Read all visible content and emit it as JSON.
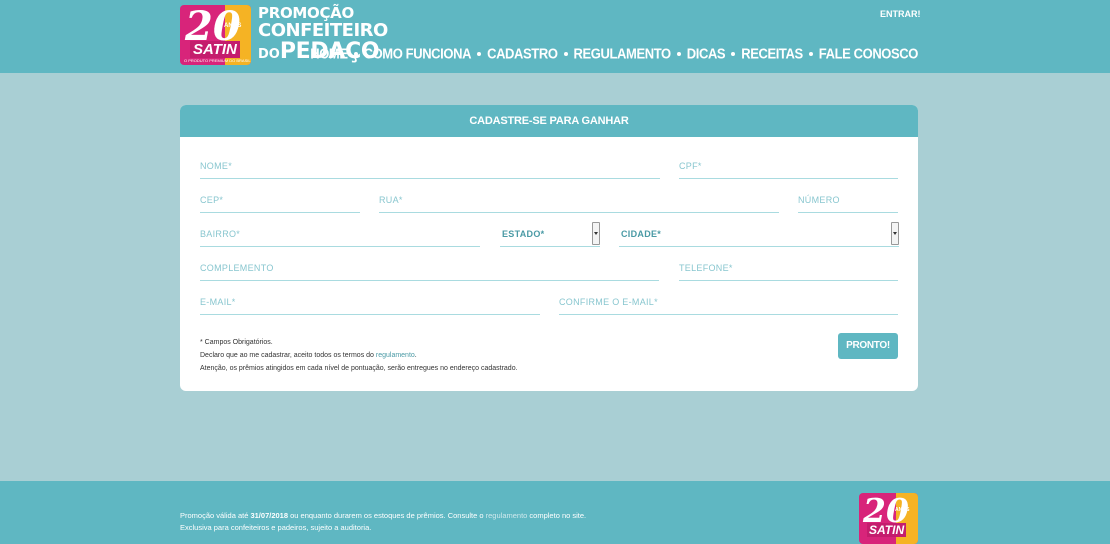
{
  "header": {
    "logo": {
      "number": "20",
      "anos": "ANOS",
      "brand": "SATIN",
      "tagline": "O PRODUTO PREMIUM DO BRASIL"
    },
    "promo_line1": "PROMOÇÃO",
    "promo_line2": "CONFEITEIRO",
    "promo_line3_small": "DO",
    "promo_line3_big": "PEDAÇO",
    "login_link": "ENTRAR!",
    "nav": [
      "HOME",
      "COMO FUNCIONA",
      "CADASTRO",
      "REGULAMENTO",
      "DICAS",
      "RECEITAS",
      "FALE CONOSCO"
    ]
  },
  "form": {
    "title": "CADASTRE-SE PARA GANHAR",
    "fields": {
      "nome": "NOME*",
      "cpf": "CPF*",
      "cep": "CEP*",
      "rua": "RUA*",
      "numero": "NÚMERO",
      "bairro": "BAIRRO*",
      "estado": "ESTADO*",
      "cidade": "CIDADE*",
      "complemento": "COMPLEMENTO",
      "telefone": "TELEFONE*",
      "email": "E-MAIL*",
      "confirm_email": "CONFIRME O E-MAIL*"
    },
    "notes": {
      "required": "* Campos Obrigatórios.",
      "declare_prefix": "Declaro que ao me cadastrar, aceito todos os termos do ",
      "declare_link": "regulamento",
      "declare_suffix": ".",
      "attention": "Atenção, os prêmios atingidos em cada nível de pontuação, serão entregues no endereço cadastrado."
    },
    "submit_label": "PRONTO!"
  },
  "footer": {
    "line1_prefix": "Promoção válida até ",
    "line1_date": "31/07/2018",
    "line1_mid": " ou enquanto durarem os estoques de prêmios. Consulte o ",
    "line1_link": "regulamento",
    "line1_suffix": " completo no site.",
    "line2": "Exclusiva para confeiteiros e padeiros, sujeito a auditoria."
  },
  "colors": {
    "teal": "#5fb7c2",
    "background": "#a9cfd4",
    "magenta": "#d8247a",
    "orange": "#f5b324"
  }
}
